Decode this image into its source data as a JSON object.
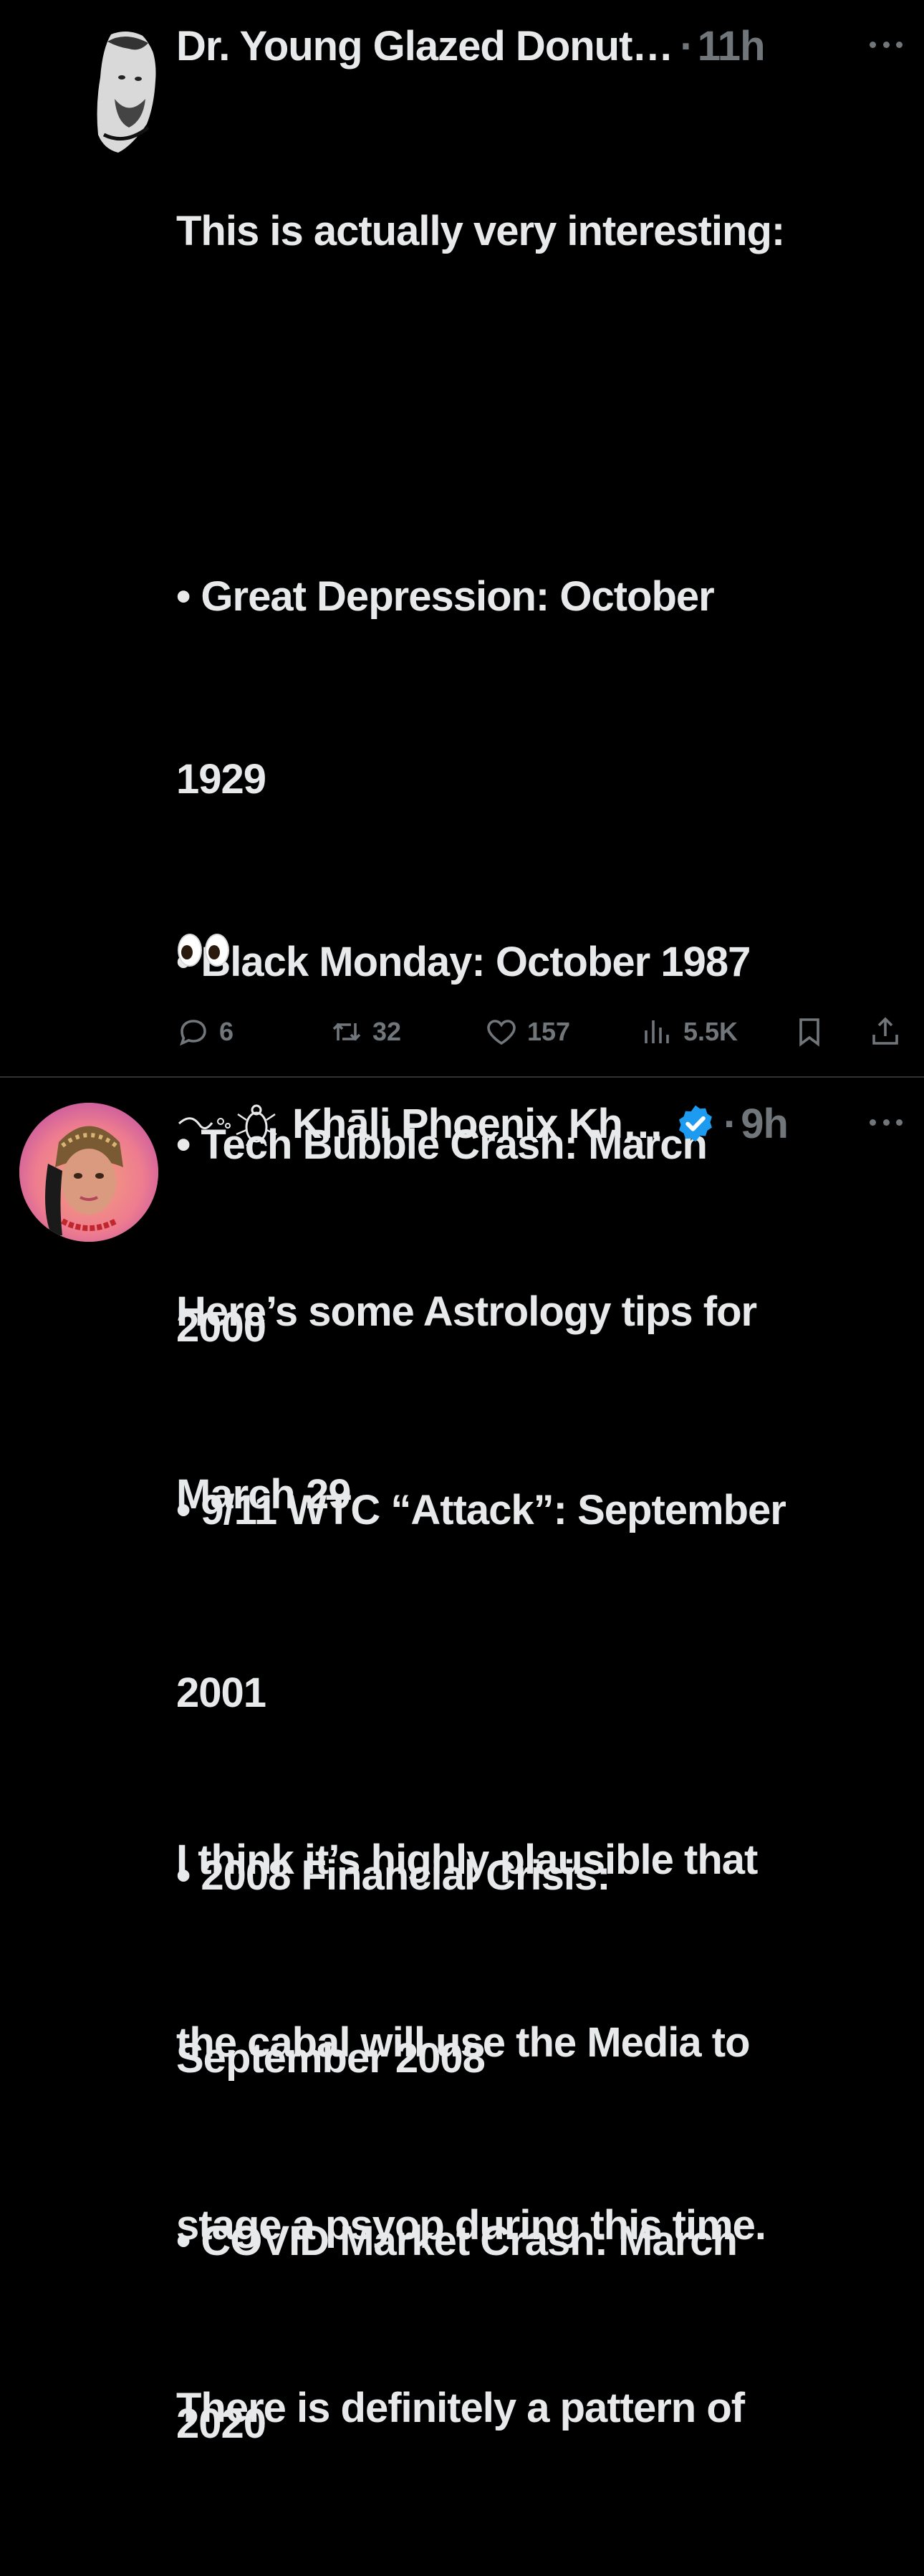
{
  "tweets": [
    {
      "author": "Dr. Young Glazed Donut…",
      "separator": "·",
      "time": "11h",
      "lines": [
        "This is actually very interesting:",
        "",
        "• Great Depression: October",
        "1929",
        "• Black Monday: October 1987",
        "• Tech Bubble Crash: March",
        "2000",
        "• 9/11 WTC “Attack”: September",
        "2001",
        "• 2008 Financial Crisis:",
        "September 2008",
        "• COVID Market Crash: March",
        "2020"
      ],
      "emoji": "👀",
      "stats": {
        "replies": "6",
        "retweets": "32",
        "likes": "157",
        "views": "5.5K"
      }
    },
    {
      "author": "Khāli Phoenix Kh…",
      "separator": "·",
      "time": "9h",
      "verified": true,
      "lines": [
        "Here’s some Astrology tips for",
        "March 29",
        "",
        "I think it’s highly plausible that",
        "the cabal will use the Media to",
        "stage a psyop during this time.",
        "There is definitely a pattern of"
      ]
    }
  ],
  "colors": {
    "background": "#000000",
    "text": "#e7e9ea",
    "secondary": "#71767b",
    "verified": "#1d9bf0",
    "divider": "#2f3336"
  },
  "icons": [
    "more-icon",
    "reply-icon",
    "retweet-icon",
    "like-icon",
    "views-icon",
    "bookmark-icon",
    "share-icon",
    "verified-icon"
  ]
}
